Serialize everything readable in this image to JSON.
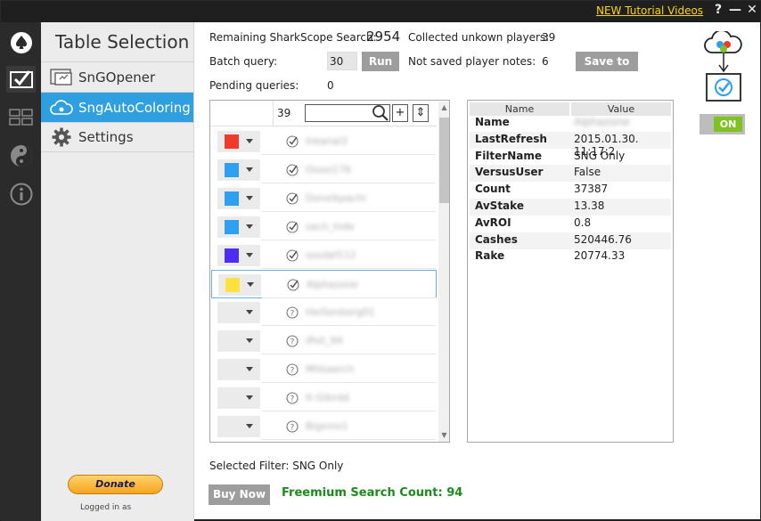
{
  "titlebar": {
    "tutorial_link": "NEW Tutorial Videos",
    "help": "?",
    "minimize": "—",
    "close": "✕"
  },
  "nav": {
    "title": "Table Selection",
    "items": [
      {
        "label": "SnGOpener",
        "icon": "opener-icon"
      },
      {
        "label": "SngAutoColoring",
        "icon": "cloud-icon",
        "active": true
      },
      {
        "label": "Settings",
        "icon": "gear-icon"
      }
    ]
  },
  "stats": {
    "remaining_label": "Remaining SharkScope Search:",
    "remaining_value": "2954",
    "collected_label": "Collected unkown players:",
    "collected_value": "39",
    "batch_label": "Batch query:",
    "batch_value": "30",
    "run_label": "Run",
    "notsaved_label": "Not saved player notes:",
    "notsaved_value": "6",
    "save_label": "Save to PS",
    "pending_label": "Pending queries:",
    "pending_value": "0"
  },
  "player_list": {
    "count": "39",
    "search_placeholder": "",
    "add": "+",
    "sort": "⇕",
    "rows": [
      {
        "color": "#f03a2c",
        "status": "check",
        "name": "Inkanal3"
      },
      {
        "color": "#2ea0ef",
        "status": "check",
        "name": "Ososi176"
      },
      {
        "color": "#2ea0ef",
        "status": "check",
        "name": "Donxikpachi"
      },
      {
        "color": "#2ea0ef",
        "status": "check",
        "name": "sach_hide"
      },
      {
        "color": "#4d2ef0",
        "status": "check",
        "name": "sosdaf112"
      },
      {
        "color": "#ffe03c",
        "status": "check",
        "name": "Alphazone",
        "selected": true
      },
      {
        "color": "",
        "status": "question",
        "name": "HeiSenberg01"
      },
      {
        "color": "",
        "status": "question",
        "name": "iPoll_94"
      },
      {
        "color": "",
        "status": "question",
        "name": "Mhbaerch"
      },
      {
        "color": "",
        "status": "question",
        "name": "It-Gibrdd"
      },
      {
        "color": "",
        "status": "question",
        "name": "Bigsmo1"
      }
    ]
  },
  "properties": {
    "name_header": "Name",
    "value_header": "Value",
    "rows": [
      {
        "key": "Name",
        "value": "Alphazone",
        "blur": true
      },
      {
        "key": "LastRefresh",
        "value": "2015.01.30. 11:17:2"
      },
      {
        "key": "FilterName",
        "value": "SNG Only"
      },
      {
        "key": "VersusUser",
        "value": "False"
      },
      {
        "key": "Count",
        "value": "37387"
      },
      {
        "key": "AvStake",
        "value": "13.38"
      },
      {
        "key": "AvROI",
        "value": "0.8"
      },
      {
        "key": "Cashes",
        "value": "520446.76"
      },
      {
        "key": "Rake",
        "value": "20774.33"
      }
    ]
  },
  "toggle": {
    "label": "ON"
  },
  "footer": {
    "selected_filter": "Selected Filter: SNG Only",
    "buy_label": "Buy Now",
    "freemium": "Freemium Search Count: 94",
    "donate": "Donate",
    "logged_in": "Logged in as"
  },
  "colors": {
    "accent": "#2f9fe0",
    "toggle_on": "#7ec321",
    "freemium": "#1c8a1c",
    "tutorial_link": "#ffd700"
  }
}
